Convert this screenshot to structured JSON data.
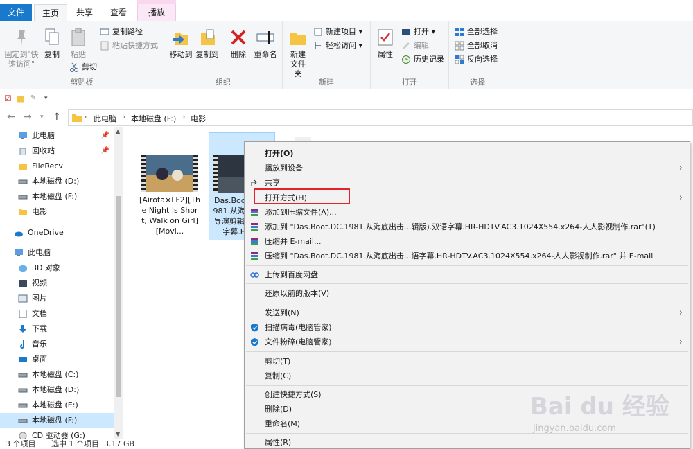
{
  "window": {
    "title": "电影"
  },
  "tabs": [
    {
      "label": "文件"
    },
    {
      "label": "主页"
    },
    {
      "label": "共享"
    },
    {
      "label": "查看"
    },
    {
      "label": "播放"
    }
  ],
  "ribbon": {
    "clipboard": {
      "label": "剪贴板",
      "pin_quick": "固定到\"快\n速访问\"",
      "copy": "复制",
      "paste": "粘贴",
      "copy_path": "复制路径",
      "paste_shortcut": "粘贴快捷方式",
      "cut": "剪切"
    },
    "organize": {
      "label": "组织",
      "move_to": "移动到",
      "copy_to": "复制到",
      "delete": "删除",
      "rename": "重命名"
    },
    "new": {
      "label": "新建",
      "new_folder": "新建\n文件夹",
      "new_item": "新建项目",
      "easy_access": "轻松访问"
    },
    "open": {
      "label": "打开",
      "properties": "属性",
      "open": "打开",
      "edit": "编辑",
      "history": "历史记录"
    },
    "select": {
      "label": "选择",
      "select_all": "全部选择",
      "select_none": "全部取消",
      "invert": "反向选择"
    }
  },
  "address": {
    "crumbs": [
      "此电脑",
      "本地磁盘 (F:)",
      "电影"
    ]
  },
  "sidebar": {
    "items": [
      {
        "label": "此电脑",
        "pinned": true
      },
      {
        "label": "回收站",
        "pinned": true
      },
      {
        "label": "FileRecv"
      },
      {
        "label": "本地磁盘 (D:)"
      },
      {
        "label": "本地磁盘 (F:)"
      },
      {
        "label": "电影"
      },
      {
        "label": "OneDrive"
      },
      {
        "label": "此电脑"
      },
      {
        "label": "3D 对象"
      },
      {
        "label": "视频"
      },
      {
        "label": "图片"
      },
      {
        "label": "文档"
      },
      {
        "label": "下载"
      },
      {
        "label": "音乐"
      },
      {
        "label": "桌面"
      },
      {
        "label": "本地磁盘 (C:)"
      },
      {
        "label": "本地磁盘 (D:)"
      },
      {
        "label": "本地磁盘 (E:)"
      },
      {
        "label": "本地磁盘 (F:)"
      },
      {
        "label": "CD 驱动器 (G:)"
      }
    ]
  },
  "files": [
    {
      "name": "[Airota×LF2][The Night Is Short, Walk on Girl][Movi..."
    },
    {
      "name": "Das.Boot.DC.1981.从海底出击.导演剪辑版.双语字幕.HR-..."
    }
  ],
  "status": {
    "count": "3 个项目",
    "selected": "选中 1 个项目",
    "size": "3.17 GB"
  },
  "context_menu": {
    "items": [
      {
        "label": "打开(O)"
      },
      {
        "label": "播放到设备"
      },
      {
        "label": "共享"
      },
      {
        "label": "打开方式(H)"
      },
      {
        "label": "添加到压缩文件(A)..."
      },
      {
        "label": "添加到 \"Das.Boot.DC.1981.从海底出击...辑版).双语字幕.HR-HDTV.AC3.1024X554.x264-人人影视制作.rar\"(T)"
      },
      {
        "label": "压缩并 E-mail..."
      },
      {
        "label": "压缩到 \"Das.Boot.DC.1981.从海底出击...语字幕.HR-HDTV.AC3.1024X554.x264-人人影视制作.rar\" 并 E-mail"
      },
      {
        "label": "上传到百度网盘"
      },
      {
        "label": "还原以前的版本(V)"
      },
      {
        "label": "发送到(N)"
      },
      {
        "label": "扫描病毒(电脑管家)"
      },
      {
        "label": "文件粉碎(电脑管家)"
      },
      {
        "label": "剪切(T)"
      },
      {
        "label": "复制(C)"
      },
      {
        "label": "创建快捷方式(S)"
      },
      {
        "label": "删除(D)"
      },
      {
        "label": "重命名(M)"
      },
      {
        "label": "属性(R)"
      }
    ]
  },
  "watermark": {
    "main": "Bai du 经验",
    "sub": "jingyan.baidu.com"
  },
  "colors": {
    "accent": "#1979ca",
    "selection": "#cce8ff",
    "highlight": "#e2232e"
  }
}
